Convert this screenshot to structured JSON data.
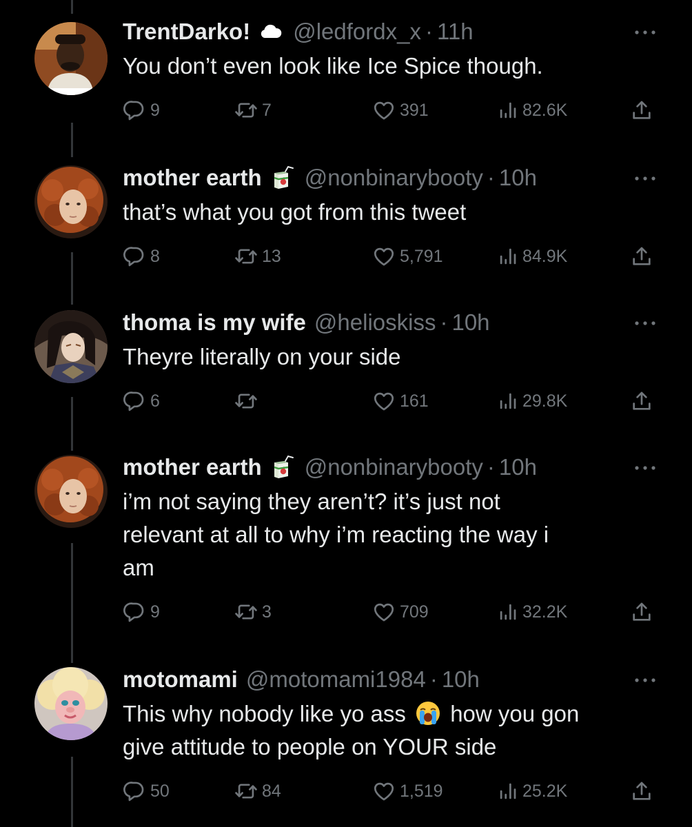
{
  "tweets": [
    {
      "name": "TrentDarko!",
      "badge_icon": "cloud-icon",
      "handle": "@ledfordx_x",
      "time": "11h",
      "text": "You don’t even look like Ice Spice though.",
      "replies": "9",
      "retweets": "7",
      "likes": "391",
      "views": "82.6K"
    },
    {
      "name": "mother earth",
      "badge_icon": "juice-box-icon",
      "handle": "@nonbinarybooty",
      "time": "10h",
      "text": "that’s what you got from this tweet",
      "replies": "8",
      "retweets": "13",
      "likes": "5,791",
      "views": "84.9K"
    },
    {
      "name": "thoma is my wife",
      "handle": "@helioskiss",
      "time": "10h",
      "text": "Theyre literally on your side",
      "replies": "6",
      "retweets": "",
      "likes": "161",
      "views": "29.8K"
    },
    {
      "name": "mother earth",
      "badge_icon": "juice-box-icon",
      "handle": "@nonbinarybooty",
      "time": "10h",
      "text_lines": [
        "i’m not saying they aren’t? it’s just not",
        "relevant at all to why i’m reacting the way i",
        "am"
      ],
      "replies": "9",
      "retweets": "3",
      "likes": "709",
      "views": "32.2K"
    },
    {
      "name": "motomami",
      "handle": "@motomami1984",
      "time": "10h",
      "text_part1": "This why nobody like yo ass",
      "emoji_icon": "loudly-crying-face-icon",
      "text_part2": "how you gon",
      "text_line2": "give attitude to people on YOUR side",
      "replies": "50",
      "retweets": "84",
      "likes": "1,519",
      "views": "25.2K"
    }
  ],
  "separator": "·",
  "colors": {
    "background": "#000000",
    "primary_text": "#e7e9ea",
    "secondary_text": "#71767b",
    "thread_line": "#333639"
  }
}
